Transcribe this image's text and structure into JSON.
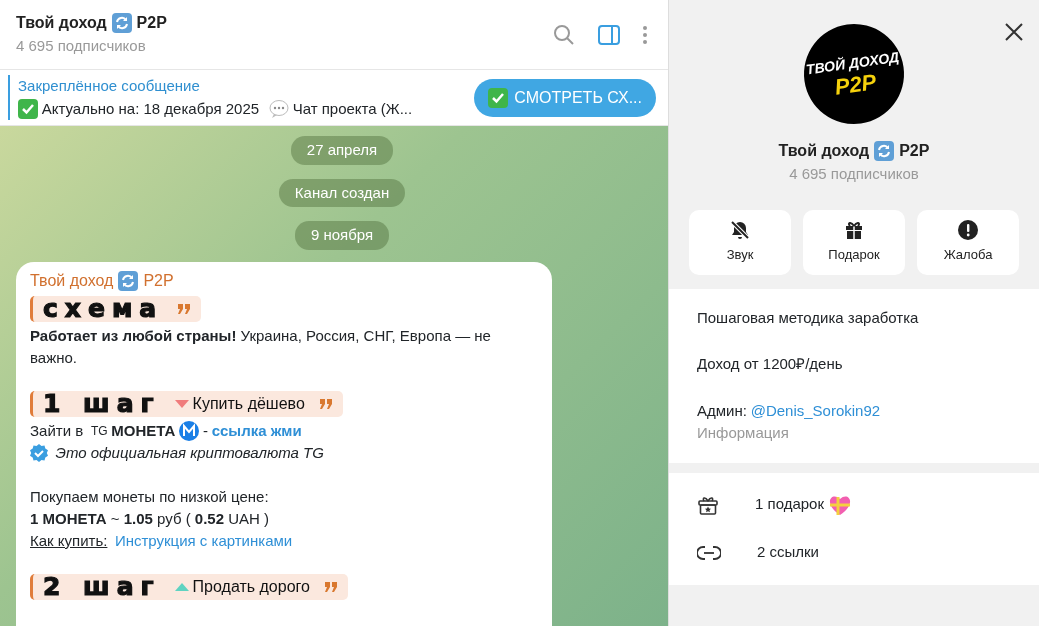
{
  "header": {
    "title_parts": [
      "Твой доход",
      "P2P"
    ],
    "subscribers": "4 695 подписчиков"
  },
  "pinned": {
    "label": "Закреплённое сообщение",
    "date_text": "Актуально на: 18 декабря 2025",
    "chat_text": "Чат проекта (Ж...",
    "button": "СМОТРЕТЬ СХ..."
  },
  "service_messages": [
    "27 апреля",
    "Канал создан",
    "9 ноября"
  ],
  "message": {
    "author_parts": [
      "Твой доход",
      "P2P"
    ],
    "sections": [
      [
        {
          "kind": "banner",
          "title": "схема"
        },
        {
          "kind": "paragraph",
          "text": "**Работает из любой страны!** Украина, Россия, СНГ, Европа — не важно."
        }
      ],
      [
        {
          "kind": "banner_down",
          "title": "1 шаг",
          "tag": "Купить дёшево"
        },
        {
          "kind": "join",
          "text": "Зайти в",
          "brand": "TG",
          "coin": "МОНЕТА",
          "separator": "-",
          "link": "ссылка жми"
        },
        {
          "kind": "verified",
          "text": "Это официальная криптовалюта TG"
        }
      ],
      [
        {
          "kind": "paragraph",
          "text": "Покупаем монеты по низкой цене:"
        },
        {
          "kind": "paragraph",
          "text": "**1 МОНЕТА** ~  **1.05** руб ( **0.52** UAH )"
        },
        {
          "kind": "howto",
          "label": "Как купить:",
          "link": "Инструкция с картинками"
        }
      ],
      [
        {
          "kind": "banner_up",
          "title": "2 шаг",
          "tag": "Продать дорого"
        }
      ]
    ]
  },
  "profile": {
    "logo_lines": [
      "ТВОЙ ДОХОД",
      "P2P"
    ],
    "name_parts": [
      "Твой доход",
      "P2P"
    ],
    "subscribers": "4 695 подписчиков",
    "actions": [
      {
        "label": "Звук",
        "kind": "mute"
      },
      {
        "label": "Подарок",
        "kind": "gift"
      },
      {
        "label": "Жалоба",
        "kind": "report"
      }
    ],
    "description": [
      "Пошаговая методика заработка",
      "Доход от 1200₽/день"
    ],
    "admin": {
      "label": "Админ:",
      "link": "@Denis_Sorokin92"
    },
    "info_caption": "Информация",
    "items": [
      {
        "kind": "gifts",
        "text": "1 подарок"
      },
      {
        "kind": "links",
        "text": "2 ссылки"
      }
    ]
  }
}
